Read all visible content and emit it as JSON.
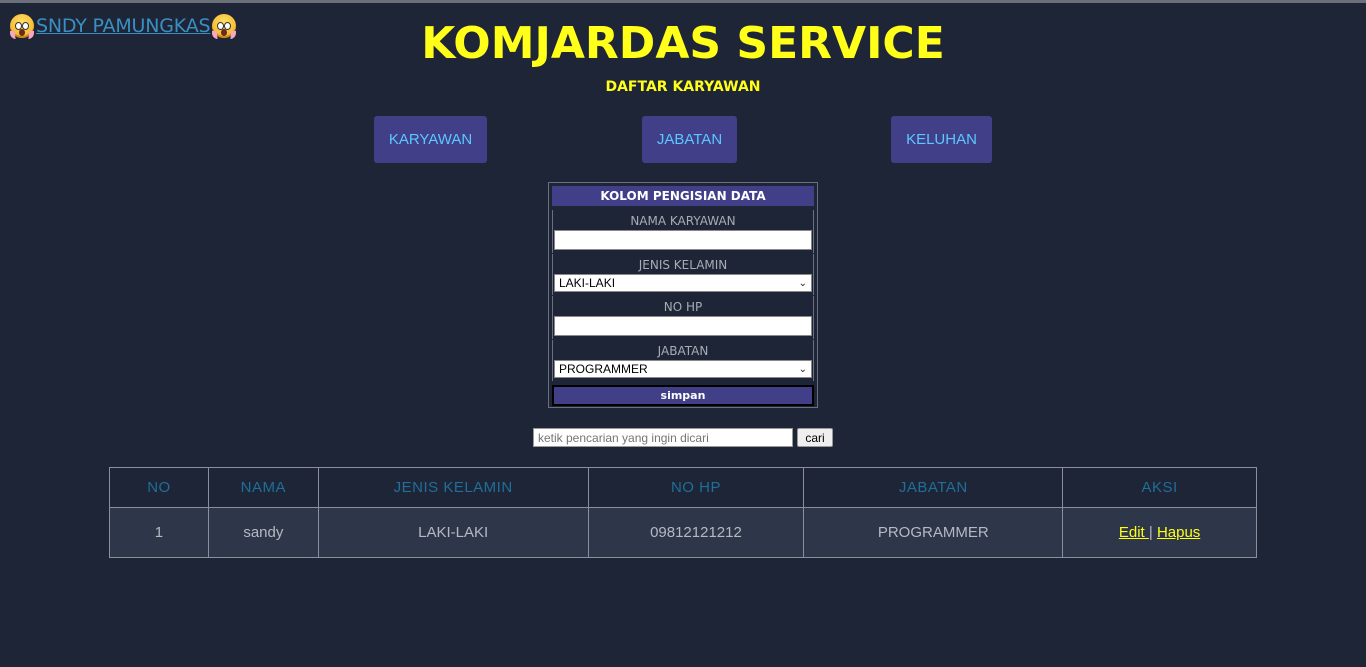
{
  "brand": {
    "link_text": "SNDY PAMUNGKAS",
    "icon": "screaming-face-emoji"
  },
  "header": {
    "title": "KOMJARDAS SERVICE",
    "subtitle": "DAFTAR KARYAWAN"
  },
  "nav": {
    "items": [
      {
        "label": "KARYAWAN"
      },
      {
        "label": "JABATAN"
      },
      {
        "label": "KELUHAN"
      }
    ]
  },
  "form": {
    "title": "KOLOM PENGISIAN DATA",
    "fields": [
      {
        "label": "NAMA KARYAWAN",
        "value": ""
      },
      {
        "label": "JENIS KELAMIN",
        "value": "LAKI-LAKI"
      },
      {
        "label": "NO HP",
        "value": ""
      },
      {
        "label": "JABATAN",
        "value": "PROGRAMMER"
      }
    ],
    "submit_label": "simpan"
  },
  "search": {
    "placeholder": "ketik pencarian yang ingin dicari",
    "button_label": "cari"
  },
  "table": {
    "columns": [
      "NO",
      "NAMA",
      "JENIS KELAMIN",
      "NO HP",
      "JABATAN",
      "AKSI"
    ],
    "rows": [
      {
        "no": "1",
        "nama": "sandy",
        "jenis_kelamin": "LAKI-LAKI",
        "no_hp": "09812121212",
        "jabatan": "PROGRAMMER",
        "edit": "Edit ",
        "separator": "|",
        "hapus": "Hapus"
      }
    ]
  },
  "colors": {
    "background": "#1e2536",
    "title": "#ffff1a",
    "button": "#403f88",
    "button_text": "#5cc8ff",
    "header_text": "#1f6f9a"
  }
}
